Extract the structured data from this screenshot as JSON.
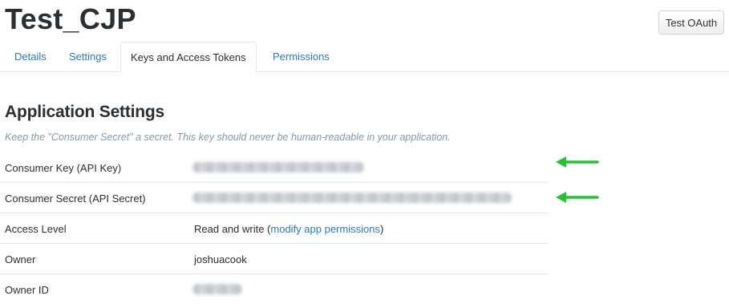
{
  "app": {
    "title": "Test_CJP"
  },
  "header": {
    "test_oauth_label": "Test OAuth"
  },
  "tabs": [
    {
      "label": "Details",
      "active": false
    },
    {
      "label": "Settings",
      "active": false
    },
    {
      "label": "Keys and Access Tokens",
      "active": true
    },
    {
      "label": "Permissions",
      "active": false
    }
  ],
  "section": {
    "title": "Application Settings",
    "hint": "Keep the \"Consumer Secret\" a secret. This key should never be human-readable in your application."
  },
  "rows": {
    "consumer_key": {
      "label": "Consumer Key (API Key)"
    },
    "consumer_secret": {
      "label": "Consumer Secret (API Secret)"
    },
    "access_level": {
      "label": "Access Level",
      "value": "Read and write (",
      "link": "modify app permissions",
      "suffix": ")"
    },
    "owner": {
      "label": "Owner",
      "value": "joshuacook"
    },
    "owner_id": {
      "label": "Owner ID"
    }
  },
  "colors": {
    "link": "#2b7bb9",
    "arrow": "#22c42f",
    "text": "#292f33",
    "hint": "#8899a6"
  },
  "icons": {
    "annotation_arrow": "left-arrow-icon"
  }
}
